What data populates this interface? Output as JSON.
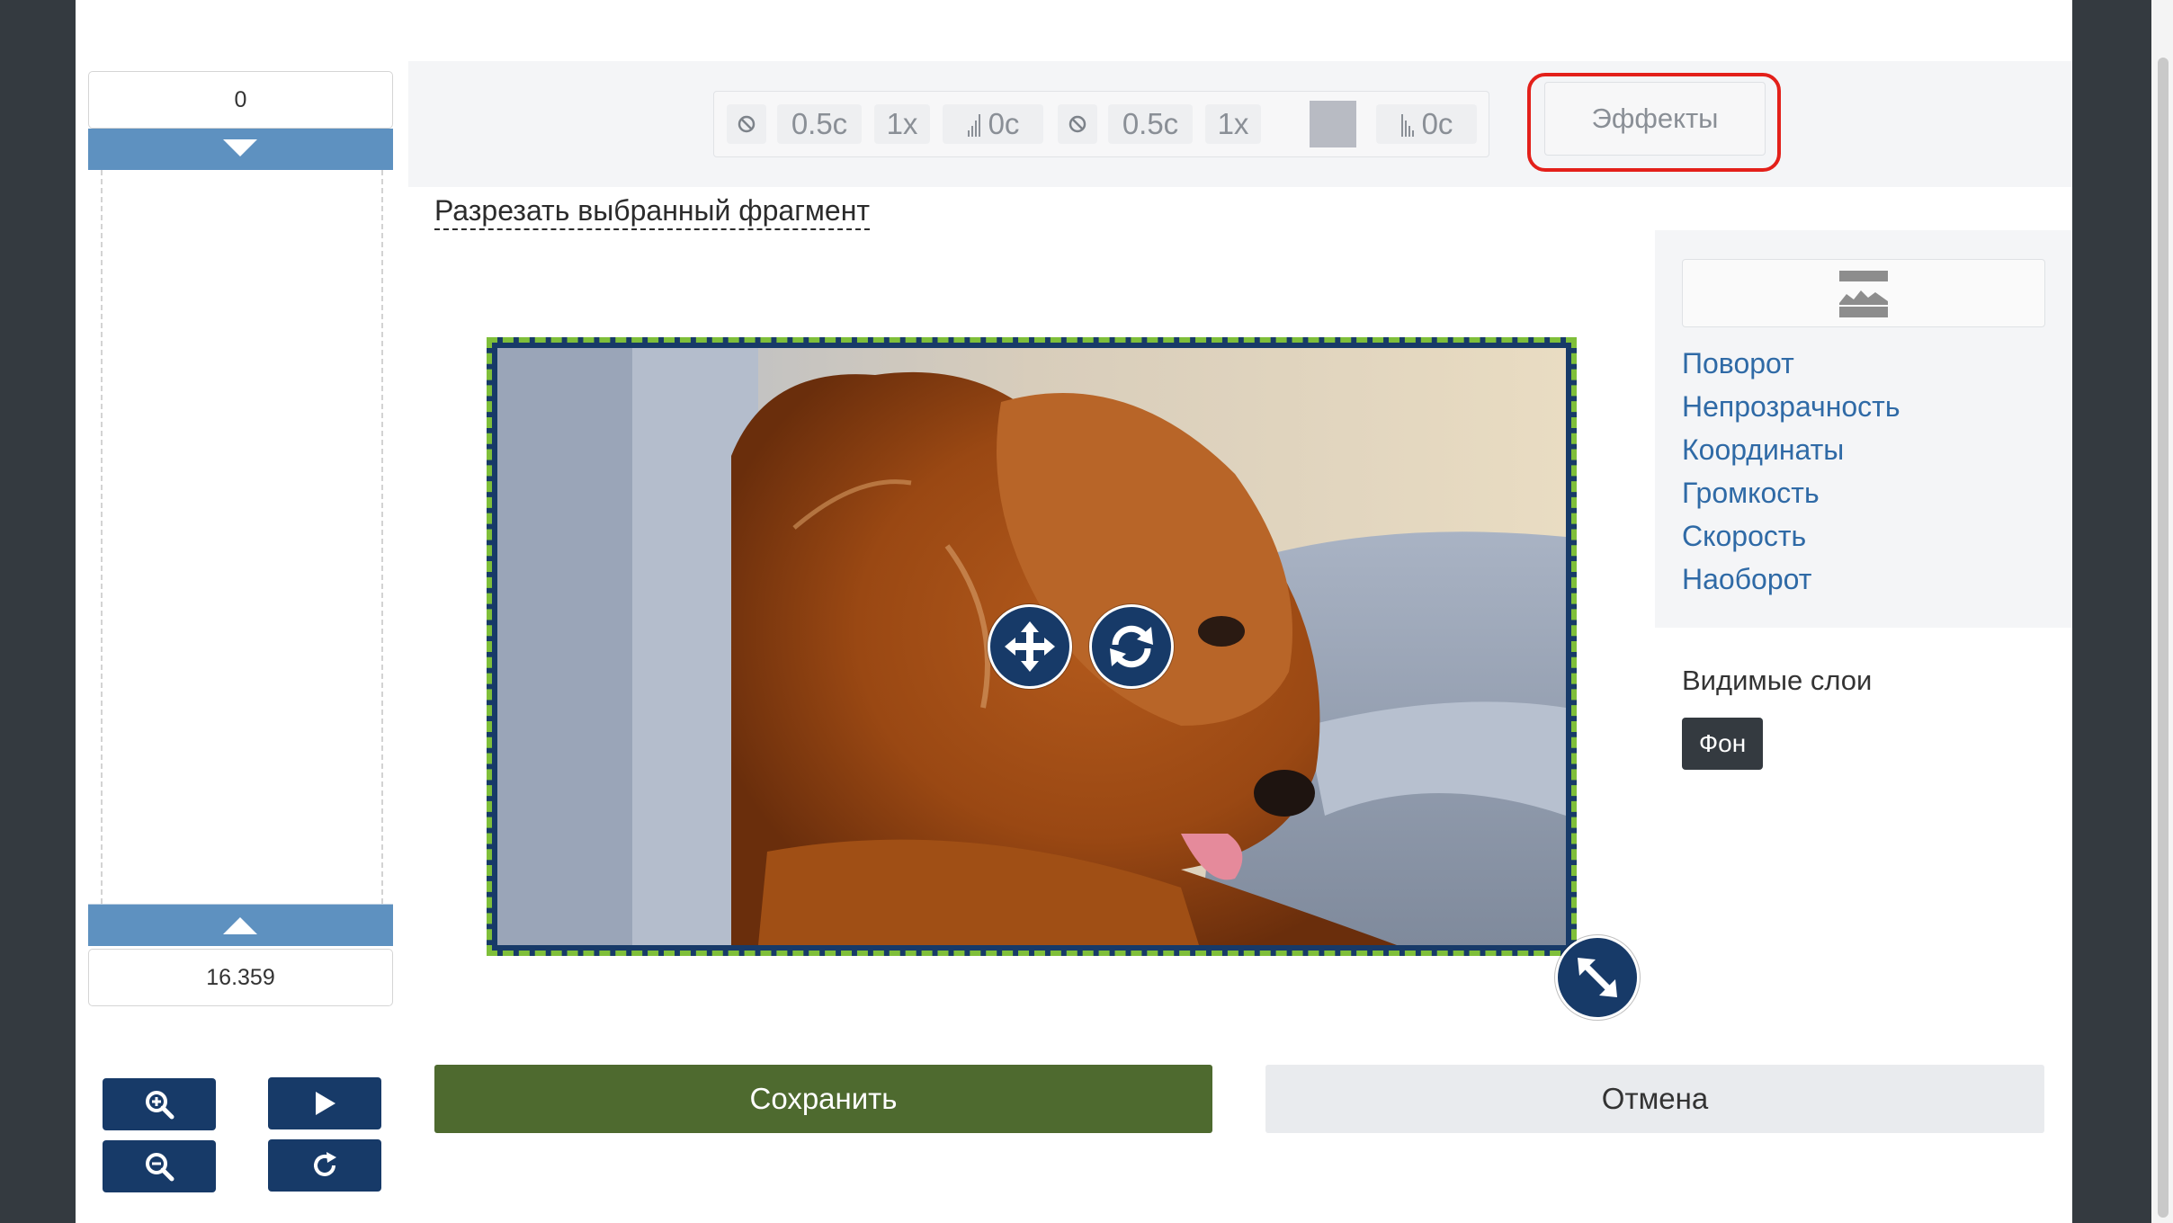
{
  "timeline": {
    "start_value": "0",
    "end_value": "16.359"
  },
  "toolbar": {
    "items": [
      {
        "type": "icon",
        "icon": "no-fade-icon"
      },
      {
        "type": "text",
        "label": "0.5с"
      },
      {
        "type": "text",
        "label": "1x"
      },
      {
        "type": "text",
        "label": "0с",
        "icon": "volume-bars-icon"
      },
      {
        "type": "icon",
        "icon": "no-fade-icon"
      },
      {
        "type": "text",
        "label": "0.5с"
      },
      {
        "type": "text",
        "label": "1x"
      },
      {
        "type": "swatch",
        "color": "#b8bbc3"
      },
      {
        "type": "text",
        "label": "0с",
        "icon": "volume-bars-icon"
      }
    ],
    "effects_label": "Эффекты",
    "highlight_color": "#e3201a"
  },
  "cut_selection_label": "Разрезать выбранный фрагмент",
  "video": {
    "description_icons": [
      "move-icon",
      "rotate-icon",
      "resize-icon"
    ],
    "border_color": "#7fbf3a"
  },
  "properties": {
    "icon": "layers-icon",
    "links": [
      "Поворот",
      "Непрозрачность",
      "Координаты",
      "Громкость",
      "Скорость",
      "Наоборот"
    ]
  },
  "visible_layers": {
    "title": "Видимые слои",
    "layers": [
      "Фон"
    ]
  },
  "actions": {
    "save_label": "Сохранить",
    "cancel_label": "Отмена"
  },
  "colors": {
    "navy": "#173a68",
    "save_green": "#4e6a2f",
    "link_blue": "#2f6aa6"
  }
}
